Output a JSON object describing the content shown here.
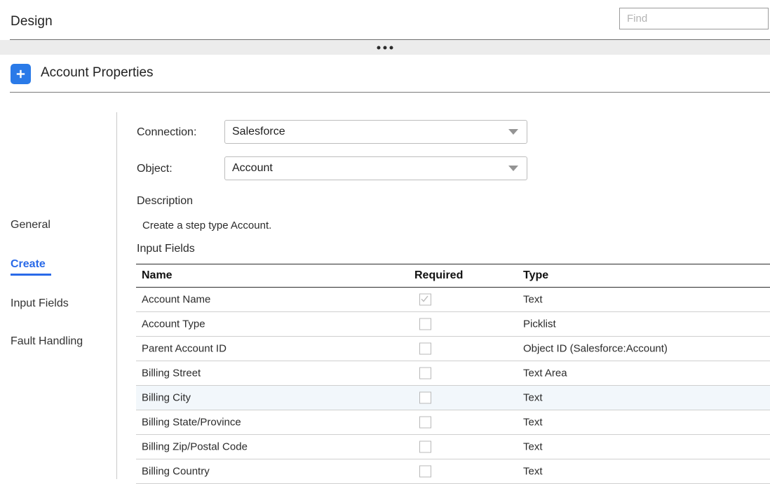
{
  "topbar": {
    "title": "Design",
    "find_placeholder": "Find",
    "find_value": "",
    "overflow_icon": "ellipsis-icon"
  },
  "section": {
    "add_icon": "plus-icon",
    "title": "Account Properties"
  },
  "sidebar": {
    "items": [
      {
        "label": "General",
        "active": false
      },
      {
        "label": "Create",
        "active": true
      },
      {
        "label": "Input Fields",
        "active": false
      },
      {
        "label": "Fault Handling",
        "active": false
      }
    ]
  },
  "form": {
    "connection_label": "Connection:",
    "connection_value": "Salesforce",
    "object_label": "Object:",
    "object_value": "Account",
    "dropdown_icon": "chevron-down-icon",
    "description_heading": "Description",
    "description_text": "Create a step type Account.",
    "input_fields_heading": "Input Fields"
  },
  "table": {
    "columns": [
      "Name",
      "Required",
      "Type"
    ],
    "rows": [
      {
        "name": "Account Name",
        "required": true,
        "type": "Text",
        "highlighted": false
      },
      {
        "name": "Account Type",
        "required": false,
        "type": "Picklist",
        "highlighted": false
      },
      {
        "name": "Parent Account ID",
        "required": false,
        "type": "Object ID (Salesforce:Account)",
        "highlighted": false
      },
      {
        "name": "Billing Street",
        "required": false,
        "type": "Text Area",
        "highlighted": false
      },
      {
        "name": "Billing City",
        "required": false,
        "type": "Text",
        "highlighted": true
      },
      {
        "name": "Billing State/Province",
        "required": false,
        "type": "Text",
        "highlighted": false
      },
      {
        "name": "Billing Zip/Postal Code",
        "required": false,
        "type": "Text",
        "highlighted": false
      },
      {
        "name": "Billing Country",
        "required": false,
        "type": "Text",
        "highlighted": false
      }
    ]
  },
  "colors": {
    "accent_blue": "#2a6ae8",
    "badge_blue": "#2a7ae8",
    "row_highlight": "#f2f7fb",
    "band_grey": "#ececec"
  }
}
